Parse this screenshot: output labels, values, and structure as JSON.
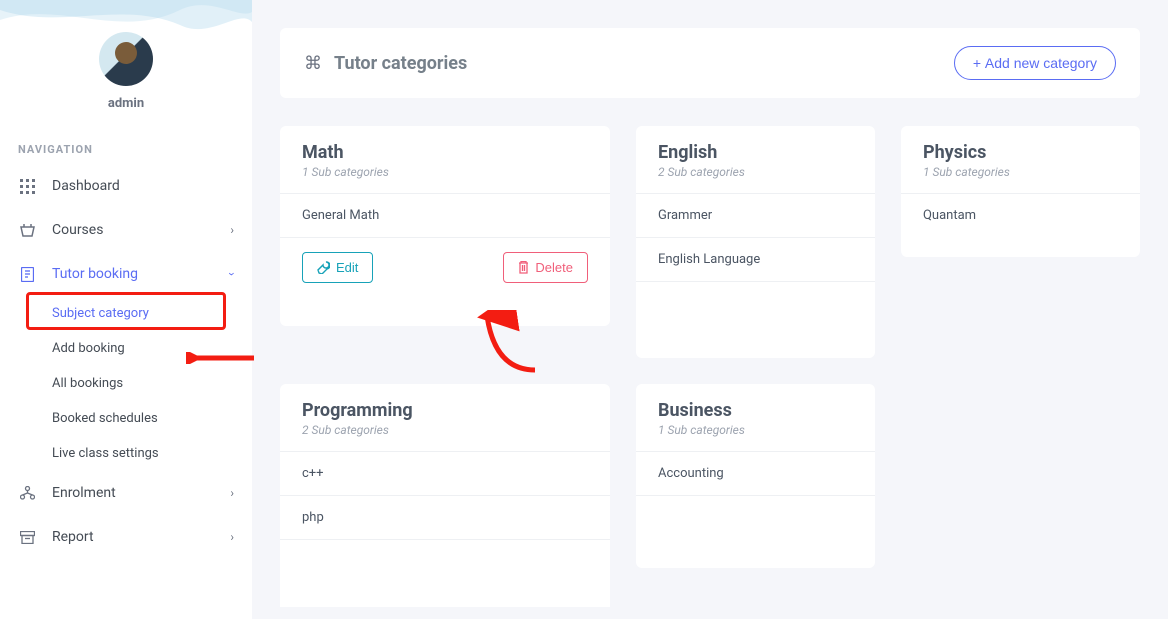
{
  "profile": {
    "username": "admin"
  },
  "sidebar": {
    "section_label": "NAVIGATION",
    "items": [
      {
        "label": "Dashboard"
      },
      {
        "label": "Courses"
      },
      {
        "label": "Tutor booking"
      },
      {
        "label": "Enrolment"
      },
      {
        "label": "Report"
      }
    ],
    "submenu": [
      {
        "label": "Subject category"
      },
      {
        "label": "Add booking"
      },
      {
        "label": "All bookings"
      },
      {
        "label": "Booked schedules"
      },
      {
        "label": "Live class settings"
      }
    ]
  },
  "header": {
    "title": "Tutor categories",
    "add_label": "Add new category"
  },
  "categories": [
    {
      "title": "Math",
      "sub": "1 Sub categories",
      "rows": [
        "General Math"
      ],
      "actions": {
        "edit": "Edit",
        "delete": "Delete"
      }
    },
    {
      "title": "English",
      "sub": "2 Sub categories",
      "rows": [
        "Grammer",
        "English Language"
      ]
    },
    {
      "title": "Physics",
      "sub": "1 Sub categories",
      "rows": [
        "Quantam"
      ]
    },
    {
      "title": "Programming",
      "sub": "2 Sub categories",
      "rows": [
        "c++",
        "php"
      ]
    },
    {
      "title": "Business",
      "sub": "1 Sub categories",
      "rows": [
        "Accounting"
      ]
    }
  ]
}
